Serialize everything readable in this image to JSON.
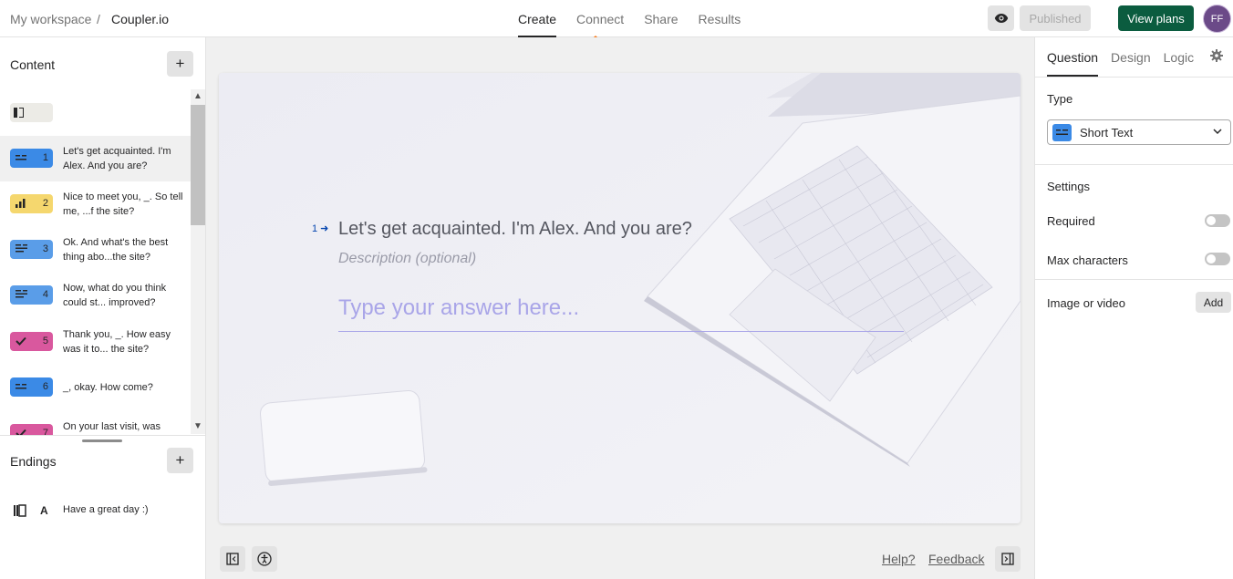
{
  "breadcrumb": {
    "workspace": "My workspace",
    "separator": "/",
    "form": "Coupler.io"
  },
  "nav_tabs": [
    {
      "label": "Create",
      "active": true
    },
    {
      "label": "Connect",
      "active": false
    },
    {
      "label": "Share",
      "active": false
    },
    {
      "label": "Results",
      "active": false
    }
  ],
  "header": {
    "preview_icon": "eye-icon",
    "published_label": "Published",
    "view_plans_label": "View plans",
    "avatar_initials": "FF"
  },
  "left": {
    "content_title": "Content",
    "add_label": "+",
    "questions": [
      {
        "num": "1",
        "text": "Let's get acquainted. I'm Alex. And you are?",
        "color": "#3b8ae6",
        "icon": "short-text-icon",
        "selected": true
      },
      {
        "num": "2",
        "text": "Nice to meet you, _. So tell me, ...f the site?",
        "color": "#f5d76e",
        "icon": "opinion-scale-icon",
        "selected": false
      },
      {
        "num": "3",
        "text": "Ok. And what's the best thing abo...the site?",
        "color": "#5a9de8",
        "icon": "long-text-icon",
        "selected": false
      },
      {
        "num": "4",
        "text": "Now, what do you think could st... improved?",
        "color": "#5a9de8",
        "icon": "long-text-icon",
        "selected": false
      },
      {
        "num": "5",
        "text": "Thank you, _. How easy was it to... the site?",
        "color": "#d9589e",
        "icon": "check-icon",
        "selected": false
      },
      {
        "num": "6",
        "text": "_, okay. How come?",
        "color": "#3b8ae6",
        "icon": "short-text-icon",
        "selected": false
      },
      {
        "num": "7",
        "text": "On your last visit, was",
        "color": "#d9589e",
        "icon": "check-icon",
        "selected": false
      }
    ],
    "endings_title": "Endings",
    "ending": {
      "num": "A",
      "text": "Have a great day :)"
    }
  },
  "question": {
    "number": "1",
    "title": "Let's get acquainted. I'm Alex. And you are?",
    "description_placeholder": "Description (optional)",
    "answer_placeholder": "Type your answer here..."
  },
  "footer": {
    "help": "Help?",
    "feedback": "Feedback"
  },
  "right": {
    "tabs": [
      "Question",
      "Design",
      "Logic"
    ],
    "type_label": "Type",
    "type_value": "Short Text",
    "settings_label": "Settings",
    "required_label": "Required",
    "required_on": false,
    "max_chars_label": "Max characters",
    "max_chars_on": false,
    "image_label": "Image or video",
    "add_label": "Add"
  },
  "colors": {
    "brand_green": "#0b5c3f",
    "accent_orange": "#f57c1f",
    "question_blue": "#0445af"
  }
}
